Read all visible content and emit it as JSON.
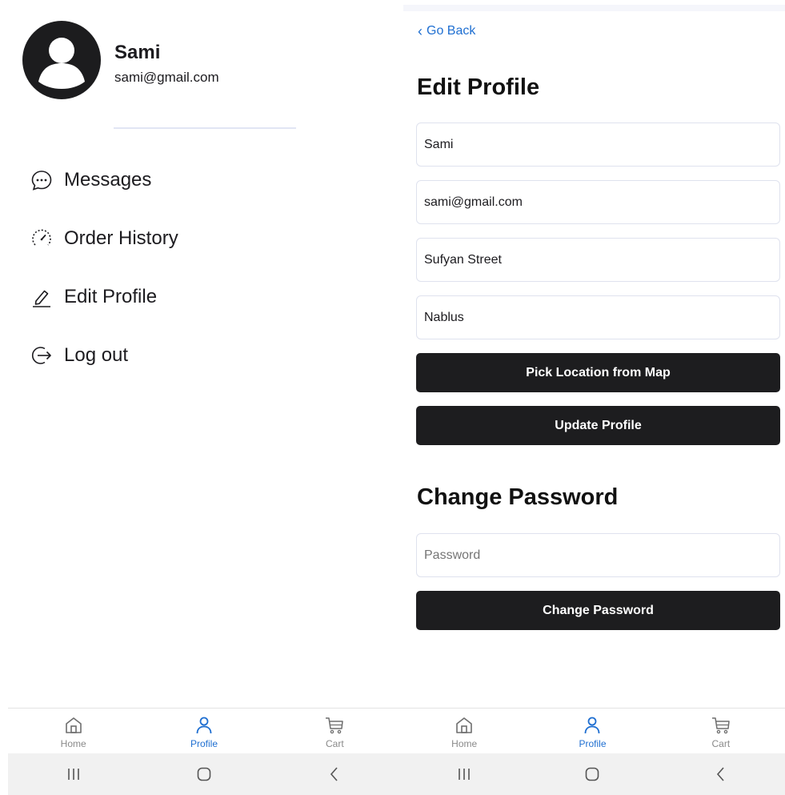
{
  "menu_screen": {
    "user": {
      "name": "Sami",
      "email": "sami@gmail.com"
    },
    "menu_items": [
      {
        "label": "Messages",
        "icon": "chat-bubble-icon"
      },
      {
        "label": "Order History",
        "icon": "speedometer-icon"
      },
      {
        "label": "Edit Profile",
        "icon": "pencil-icon"
      },
      {
        "label": "Log out",
        "icon": "logout-icon"
      }
    ]
  },
  "edit_screen": {
    "go_back": "Go Back",
    "edit_profile_title": "Edit Profile",
    "fields": {
      "name": "Sami",
      "email": "sami@gmail.com",
      "street": "Sufyan Street",
      "city": "Nablus"
    },
    "pick_location_label": "Pick Location from Map",
    "update_profile_label": "Update Profile",
    "change_password_title": "Change Password",
    "password_placeholder": "Password",
    "change_password_label": "Change Password"
  },
  "bottom_nav": {
    "items": [
      {
        "label": "Home",
        "icon": "home-icon"
      },
      {
        "label": "Profile",
        "icon": "person-icon",
        "active": true
      },
      {
        "label": "Cart",
        "icon": "cart-icon"
      }
    ]
  },
  "colors": {
    "accent": "#1f6fd1",
    "button_dark": "#1d1d1f",
    "avatar": "#1c1c1e",
    "inactive_nav": "#8a8a8a"
  }
}
